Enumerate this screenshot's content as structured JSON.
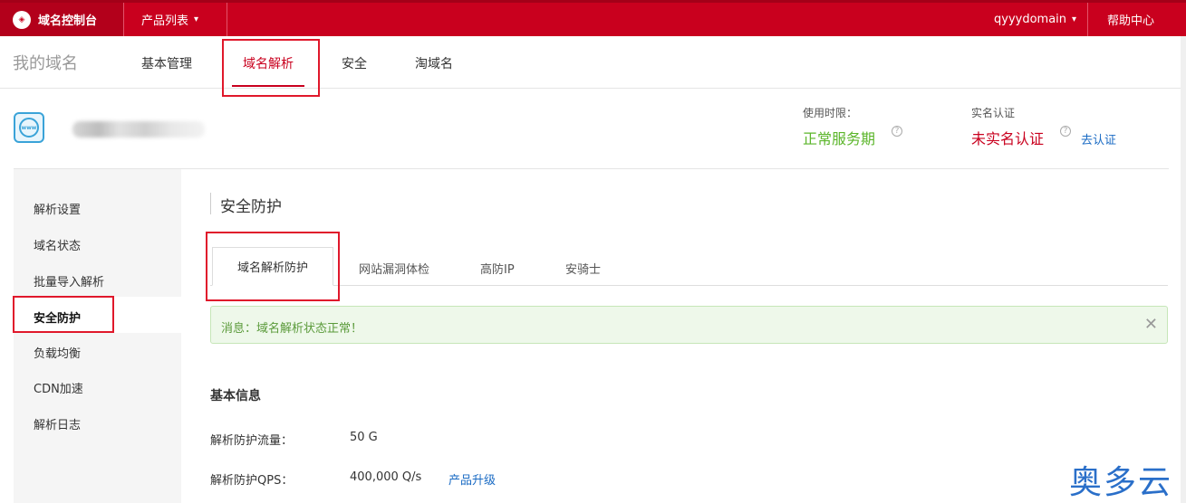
{
  "topbar": {
    "brand": "域名控制台",
    "brand_logo": "logo",
    "products": "产品列表",
    "user": "qyyydomain",
    "help": "帮助中心"
  },
  "subnav": {
    "title": "我的域名",
    "tabs": [
      {
        "label": "基本管理"
      },
      {
        "label": "域名解析"
      },
      {
        "label": "安全"
      },
      {
        "label": "淘域名"
      }
    ]
  },
  "domain_info": {
    "usage_label": "使用时限：",
    "usage_status": "正常服务期",
    "realname_label": "实名认证",
    "realname_status": "未实名认证",
    "verify_link": "去认证"
  },
  "sidebar": {
    "items": [
      {
        "label": "解析设置"
      },
      {
        "label": "域名状态"
      },
      {
        "label": "批量导入解析"
      },
      {
        "label": "安全防护"
      },
      {
        "label": "负载均衡"
      },
      {
        "label": "CDN加速"
      },
      {
        "label": "解析日志"
      }
    ]
  },
  "content": {
    "section_title": "安全防护",
    "tabs": [
      {
        "label": "域名解析防护"
      },
      {
        "label": "网站漏洞体检"
      },
      {
        "label": "高防IP"
      },
      {
        "label": "安骑士"
      }
    ],
    "alert": "消息：域名解析状态正常！",
    "alert_close": "✕",
    "basic_title": "基本信息",
    "flow_label": "解析防护流量：",
    "flow_value": "50 G",
    "qps_label": "解析防护QPS：",
    "qps_value": "400,000 Q/s",
    "upgrade_link": "产品升级"
  },
  "watermark": "奥多云",
  "colors": {
    "brand_red": "#c9001e",
    "ok_green": "#5bb52a",
    "link_blue": "#1a6bc4"
  }
}
